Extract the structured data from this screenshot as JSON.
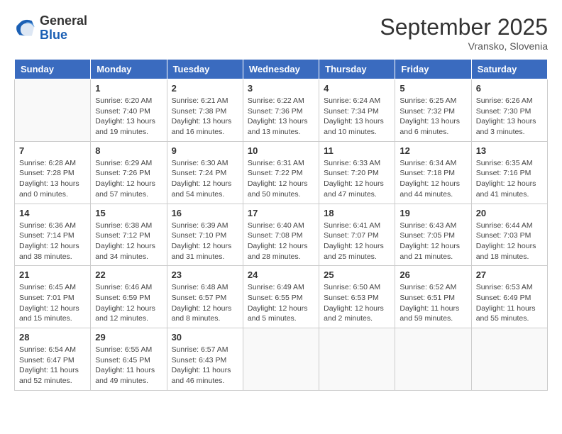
{
  "header": {
    "logo_general": "General",
    "logo_blue": "Blue",
    "month_title": "September 2025",
    "location": "Vransko, Slovenia"
  },
  "weekdays": [
    "Sunday",
    "Monday",
    "Tuesday",
    "Wednesday",
    "Thursday",
    "Friday",
    "Saturday"
  ],
  "weeks": [
    [
      {
        "day": "",
        "info": ""
      },
      {
        "day": "1",
        "info": "Sunrise: 6:20 AM\nSunset: 7:40 PM\nDaylight: 13 hours\nand 19 minutes."
      },
      {
        "day": "2",
        "info": "Sunrise: 6:21 AM\nSunset: 7:38 PM\nDaylight: 13 hours\nand 16 minutes."
      },
      {
        "day": "3",
        "info": "Sunrise: 6:22 AM\nSunset: 7:36 PM\nDaylight: 13 hours\nand 13 minutes."
      },
      {
        "day": "4",
        "info": "Sunrise: 6:24 AM\nSunset: 7:34 PM\nDaylight: 13 hours\nand 10 minutes."
      },
      {
        "day": "5",
        "info": "Sunrise: 6:25 AM\nSunset: 7:32 PM\nDaylight: 13 hours\nand 6 minutes."
      },
      {
        "day": "6",
        "info": "Sunrise: 6:26 AM\nSunset: 7:30 PM\nDaylight: 13 hours\nand 3 minutes."
      }
    ],
    [
      {
        "day": "7",
        "info": "Sunrise: 6:28 AM\nSunset: 7:28 PM\nDaylight: 13 hours\nand 0 minutes."
      },
      {
        "day": "8",
        "info": "Sunrise: 6:29 AM\nSunset: 7:26 PM\nDaylight: 12 hours\nand 57 minutes."
      },
      {
        "day": "9",
        "info": "Sunrise: 6:30 AM\nSunset: 7:24 PM\nDaylight: 12 hours\nand 54 minutes."
      },
      {
        "day": "10",
        "info": "Sunrise: 6:31 AM\nSunset: 7:22 PM\nDaylight: 12 hours\nand 50 minutes."
      },
      {
        "day": "11",
        "info": "Sunrise: 6:33 AM\nSunset: 7:20 PM\nDaylight: 12 hours\nand 47 minutes."
      },
      {
        "day": "12",
        "info": "Sunrise: 6:34 AM\nSunset: 7:18 PM\nDaylight: 12 hours\nand 44 minutes."
      },
      {
        "day": "13",
        "info": "Sunrise: 6:35 AM\nSunset: 7:16 PM\nDaylight: 12 hours\nand 41 minutes."
      }
    ],
    [
      {
        "day": "14",
        "info": "Sunrise: 6:36 AM\nSunset: 7:14 PM\nDaylight: 12 hours\nand 38 minutes."
      },
      {
        "day": "15",
        "info": "Sunrise: 6:38 AM\nSunset: 7:12 PM\nDaylight: 12 hours\nand 34 minutes."
      },
      {
        "day": "16",
        "info": "Sunrise: 6:39 AM\nSunset: 7:10 PM\nDaylight: 12 hours\nand 31 minutes."
      },
      {
        "day": "17",
        "info": "Sunrise: 6:40 AM\nSunset: 7:08 PM\nDaylight: 12 hours\nand 28 minutes."
      },
      {
        "day": "18",
        "info": "Sunrise: 6:41 AM\nSunset: 7:07 PM\nDaylight: 12 hours\nand 25 minutes."
      },
      {
        "day": "19",
        "info": "Sunrise: 6:43 AM\nSunset: 7:05 PM\nDaylight: 12 hours\nand 21 minutes."
      },
      {
        "day": "20",
        "info": "Sunrise: 6:44 AM\nSunset: 7:03 PM\nDaylight: 12 hours\nand 18 minutes."
      }
    ],
    [
      {
        "day": "21",
        "info": "Sunrise: 6:45 AM\nSunset: 7:01 PM\nDaylight: 12 hours\nand 15 minutes."
      },
      {
        "day": "22",
        "info": "Sunrise: 6:46 AM\nSunset: 6:59 PM\nDaylight: 12 hours\nand 12 minutes."
      },
      {
        "day": "23",
        "info": "Sunrise: 6:48 AM\nSunset: 6:57 PM\nDaylight: 12 hours\nand 8 minutes."
      },
      {
        "day": "24",
        "info": "Sunrise: 6:49 AM\nSunset: 6:55 PM\nDaylight: 12 hours\nand 5 minutes."
      },
      {
        "day": "25",
        "info": "Sunrise: 6:50 AM\nSunset: 6:53 PM\nDaylight: 12 hours\nand 2 minutes."
      },
      {
        "day": "26",
        "info": "Sunrise: 6:52 AM\nSunset: 6:51 PM\nDaylight: 11 hours\nand 59 minutes."
      },
      {
        "day": "27",
        "info": "Sunrise: 6:53 AM\nSunset: 6:49 PM\nDaylight: 11 hours\nand 55 minutes."
      }
    ],
    [
      {
        "day": "28",
        "info": "Sunrise: 6:54 AM\nSunset: 6:47 PM\nDaylight: 11 hours\nand 52 minutes."
      },
      {
        "day": "29",
        "info": "Sunrise: 6:55 AM\nSunset: 6:45 PM\nDaylight: 11 hours\nand 49 minutes."
      },
      {
        "day": "30",
        "info": "Sunrise: 6:57 AM\nSunset: 6:43 PM\nDaylight: 11 hours\nand 46 minutes."
      },
      {
        "day": "",
        "info": ""
      },
      {
        "day": "",
        "info": ""
      },
      {
        "day": "",
        "info": ""
      },
      {
        "day": "",
        "info": ""
      }
    ]
  ]
}
